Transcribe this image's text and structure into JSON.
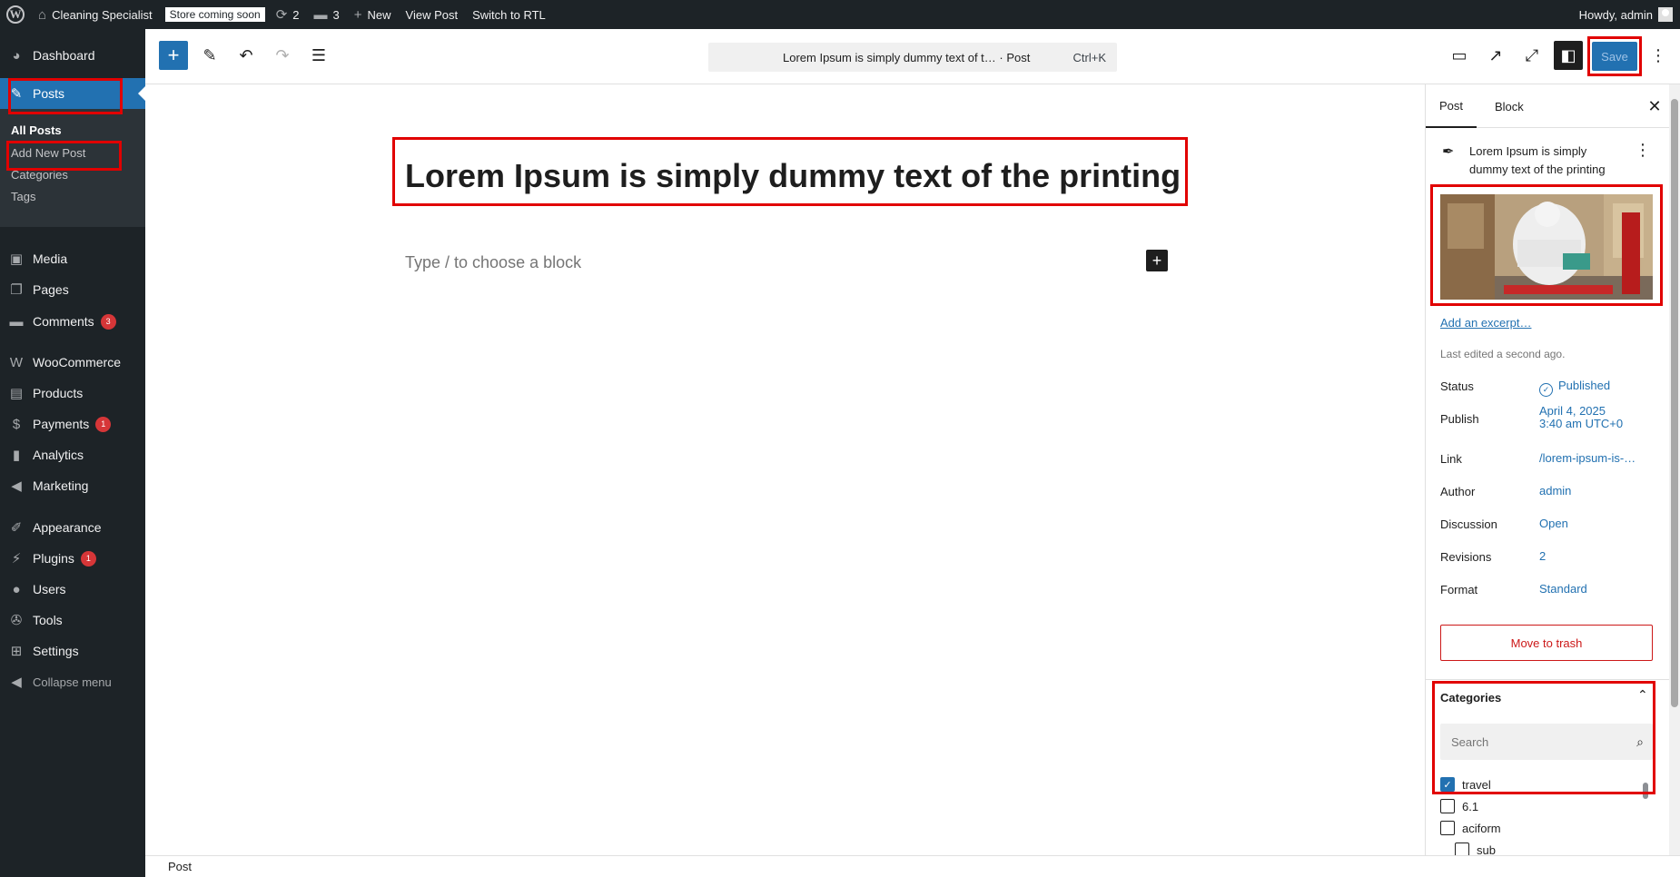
{
  "admin_bar": {
    "site_name": "Cleaning Specialist",
    "store_badge": "Store coming soon",
    "updates_count": "2",
    "comments_count": "3",
    "new_label": "New",
    "view_post": "View Post",
    "switch_rtl": "Switch to RTL",
    "howdy": "Howdy, admin"
  },
  "menu": {
    "dashboard": "Dashboard",
    "posts": "Posts",
    "submenu": {
      "all_posts": "All Posts",
      "add_new": "Add New Post",
      "categories": "Categories",
      "tags": "Tags"
    },
    "media": "Media",
    "pages": "Pages",
    "comments": "Comments",
    "comments_badge": "3",
    "woocommerce": "WooCommerce",
    "products": "Products",
    "payments": "Payments",
    "payments_badge": "1",
    "analytics": "Analytics",
    "marketing": "Marketing",
    "appearance": "Appearance",
    "plugins": "Plugins",
    "plugins_badge": "1",
    "users": "Users",
    "tools": "Tools",
    "settings": "Settings",
    "collapse": "Collapse menu"
  },
  "toolbar": {
    "doc_title": "Lorem Ipsum is simply dummy text of t… · Post",
    "shortcut": "Ctrl+K",
    "save": "Save"
  },
  "editor": {
    "title": "Lorem Ipsum is simply dummy text of the printing",
    "placeholder": "Type / to choose a block"
  },
  "sidebar": {
    "tab_post": "Post",
    "tab_block": "Block",
    "summary_title": "Lorem Ipsum is simply dummy text of the printing",
    "add_excerpt": "Add an excerpt…",
    "last_edited": "Last edited a second ago.",
    "rows": {
      "status_label": "Status",
      "status_value": "Published",
      "publish_label": "Publish",
      "publish_date": "April 4, 2025",
      "publish_time": "3:40 am UTC+0",
      "link_label": "Link",
      "link_value": "/lorem-ipsum-is-…",
      "author_label": "Author",
      "author_value": "admin",
      "discussion_label": "Discussion",
      "discussion_value": "Open",
      "revisions_label": "Revisions",
      "revisions_value": "2",
      "format_label": "Format",
      "format_value": "Standard"
    },
    "trash": "Move to trash",
    "categories": {
      "heading": "Categories",
      "search_placeholder": "Search",
      "items": [
        {
          "label": "travel",
          "checked": true
        },
        {
          "label": "6.1",
          "checked": false
        },
        {
          "label": "aciform",
          "checked": false
        },
        {
          "label": "sub",
          "checked": false
        }
      ]
    }
  },
  "footer": {
    "breadcrumb": "Post"
  },
  "colors": {
    "accent": "#2271b1",
    "admin_dark": "#1d2327",
    "danger": "#cc1818",
    "highlight": "#e10000"
  }
}
